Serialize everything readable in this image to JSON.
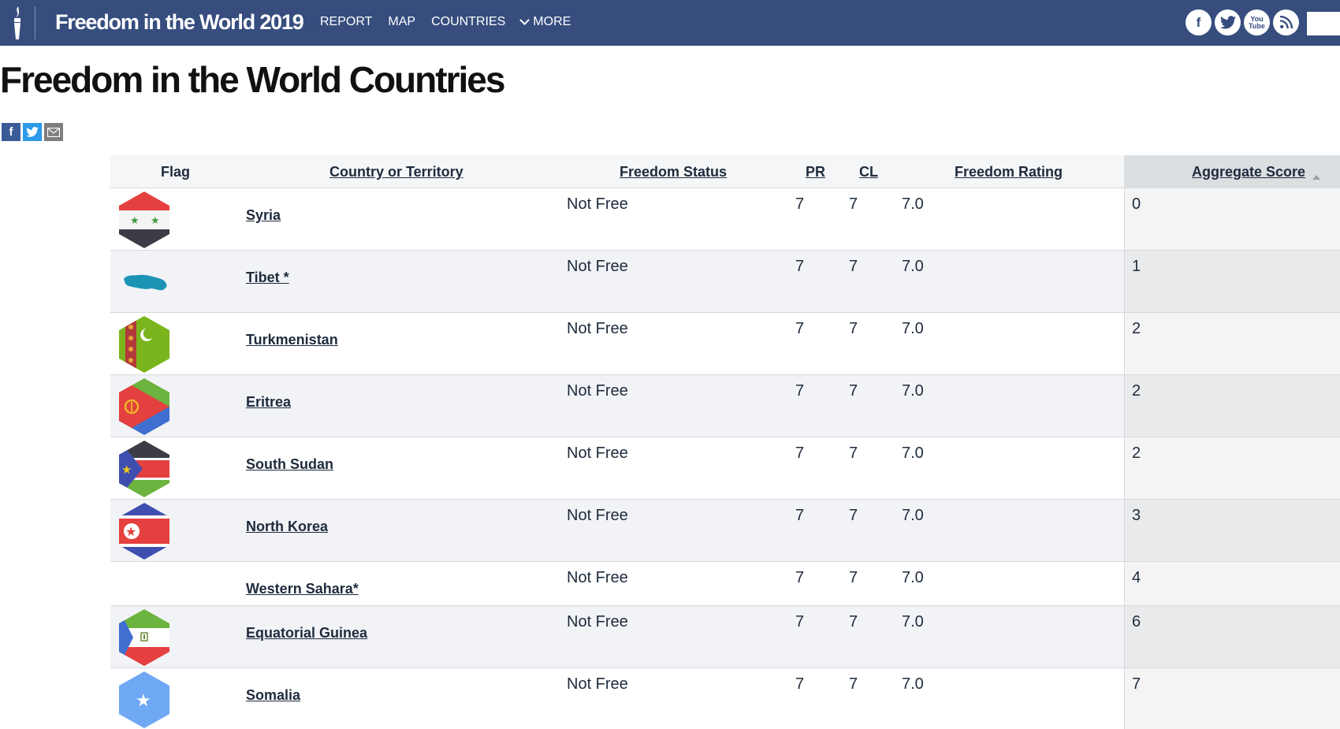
{
  "header": {
    "site_title": "Freedom in the World 2019",
    "nav": [
      "REPORT",
      "MAP",
      "COUNTRIES",
      "MORE"
    ],
    "social_icons": [
      "facebook-icon",
      "twitter-icon",
      "youtube-icon",
      "rss-icon"
    ],
    "youtube_text": "You Tube",
    "brand_color": "#364d7e"
  },
  "page": {
    "title": "Freedom in the World Countries",
    "share_icons": [
      "facebook-share-icon",
      "twitter-share-icon",
      "email-share-icon"
    ]
  },
  "table": {
    "columns": {
      "flag": "Flag",
      "country": "Country or Territory",
      "status": "Freedom Status",
      "pr": "PR",
      "cl": "CL",
      "rating": "Freedom Rating",
      "score": "Aggregate Score"
    },
    "sorted_by": "Aggregate Score",
    "sort_direction": "ascending",
    "rows": [
      {
        "flag": "syria-flag",
        "country": "Syria",
        "status": "Not Free",
        "pr": "7",
        "cl": "7",
        "rating": "7.0",
        "score": "0"
      },
      {
        "flag": "tibet-map-icon",
        "country": "Tibet *",
        "status": "Not Free",
        "pr": "7",
        "cl": "7",
        "rating": "7.0",
        "score": "1"
      },
      {
        "flag": "turkmenistan-flag",
        "country": "Turkmenistan",
        "status": "Not Free",
        "pr": "7",
        "cl": "7",
        "rating": "7.0",
        "score": "2"
      },
      {
        "flag": "eritrea-flag",
        "country": "Eritrea",
        "status": "Not Free",
        "pr": "7",
        "cl": "7",
        "rating": "7.0",
        "score": "2"
      },
      {
        "flag": "south-sudan-flag",
        "country": "South Sudan",
        "status": "Not Free",
        "pr": "7",
        "cl": "7",
        "rating": "7.0",
        "score": "2"
      },
      {
        "flag": "north-korea-flag",
        "country": "North Korea",
        "status": "Not Free",
        "pr": "7",
        "cl": "7",
        "rating": "7.0",
        "score": "3"
      },
      {
        "flag": null,
        "country": "Western Sahara*",
        "status": "Not Free",
        "pr": "7",
        "cl": "7",
        "rating": "7.0",
        "score": "4"
      },
      {
        "flag": "equatorial-guinea-flag",
        "country": "Equatorial Guinea",
        "status": "Not Free",
        "pr": "7",
        "cl": "7",
        "rating": "7.0",
        "score": "6"
      },
      {
        "flag": "somalia-flag",
        "country": "Somalia",
        "status": "Not Free",
        "pr": "7",
        "cl": "7",
        "rating": "7.0",
        "score": "7"
      }
    ]
  }
}
